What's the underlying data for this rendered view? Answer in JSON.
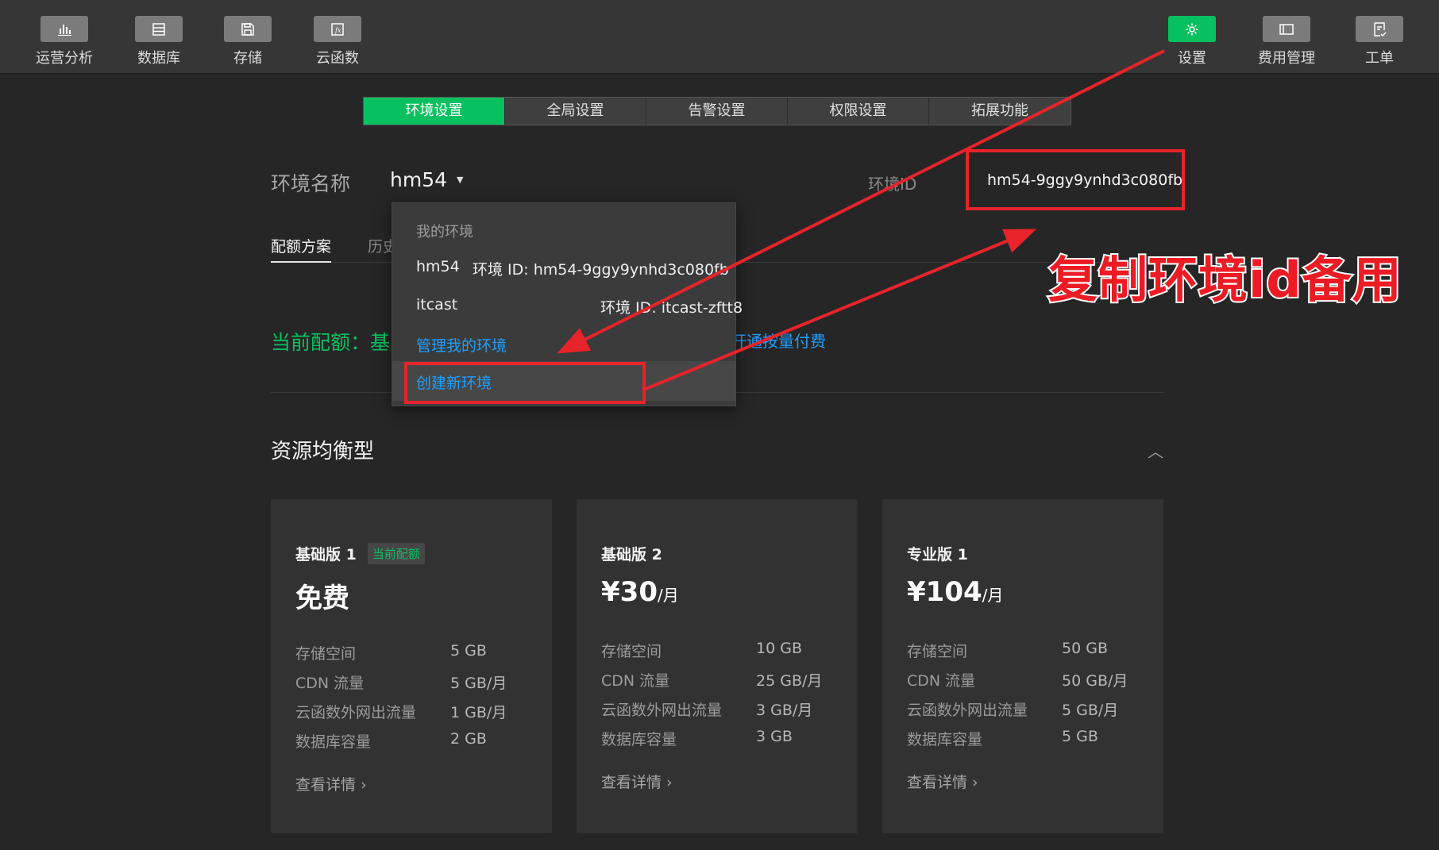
{
  "toolbar": {
    "left": [
      {
        "label": "运营分析",
        "icon": "bar-chart-icon"
      },
      {
        "label": "数据库",
        "icon": "database-icon"
      },
      {
        "label": "存储",
        "icon": "save-icon"
      },
      {
        "label": "云函数",
        "icon": "function-icon"
      }
    ],
    "right": [
      {
        "label": "设置",
        "icon": "gear-icon",
        "active": true
      },
      {
        "label": "费用管理",
        "icon": "billing-icon"
      },
      {
        "label": "工单",
        "icon": "ticket-icon"
      }
    ]
  },
  "tabs": [
    "环境设置",
    "全局设置",
    "告警设置",
    "权限设置",
    "拓展功能"
  ],
  "env": {
    "name_label": "环境名称",
    "name_value": "hm54",
    "id_label": "环境ID",
    "id_value": "hm54-9ggy9ynhd3c080fb"
  },
  "subtabs": [
    "配额方案",
    "历史"
  ],
  "quota": {
    "current": "当前配额：基",
    "link": "开通按量付费"
  },
  "section": {
    "title": "资源均衡型"
  },
  "plans": [
    {
      "name": "基础版 1",
      "badge": "当前配额",
      "price": "免费",
      "unit": "",
      "specs": [
        {
          "k": "存储空间",
          "v": "5 GB"
        },
        {
          "k": "CDN 流量",
          "v": "5 GB/月"
        },
        {
          "k": "云函数外网出流量",
          "v": "1 GB/月"
        },
        {
          "k": "数据库容量",
          "v": "2 GB"
        }
      ],
      "detail": "查看详情 ›"
    },
    {
      "name": "基础版 2",
      "badge": "",
      "price": "¥30",
      "unit": "/月",
      "specs": [
        {
          "k": "存储空间",
          "v": "10 GB"
        },
        {
          "k": "CDN 流量",
          "v": "25 GB/月"
        },
        {
          "k": "云函数外网出流量",
          "v": "3 GB/月"
        },
        {
          "k": "数据库容量",
          "v": "3 GB"
        }
      ],
      "detail": "查看详情 ›"
    },
    {
      "name": "专业版 1",
      "badge": "",
      "price": "¥104",
      "unit": "/月",
      "specs": [
        {
          "k": "存储空间",
          "v": "50 GB"
        },
        {
          "k": "CDN 流量",
          "v": "50 GB/月"
        },
        {
          "k": "云函数外网出流量",
          "v": "5 GB/月"
        },
        {
          "k": "数据库容量",
          "v": "5 GB"
        }
      ],
      "detail": "查看详情 ›"
    }
  ],
  "dropdown": {
    "header": "我的环境",
    "items": [
      {
        "name": "hm54",
        "id": "环境 ID: hm54-9ggy9ynhd3c080fb"
      },
      {
        "name": "itcast",
        "id": "环境 ID: itcast-zftt8"
      }
    ],
    "manage": "管理我的环境",
    "create": "创建新环境"
  },
  "annotation": "复制环境id备用",
  "colors": {
    "accent": "#07c160",
    "link": "#1e9fff",
    "annotation_red": "#e8232a"
  }
}
